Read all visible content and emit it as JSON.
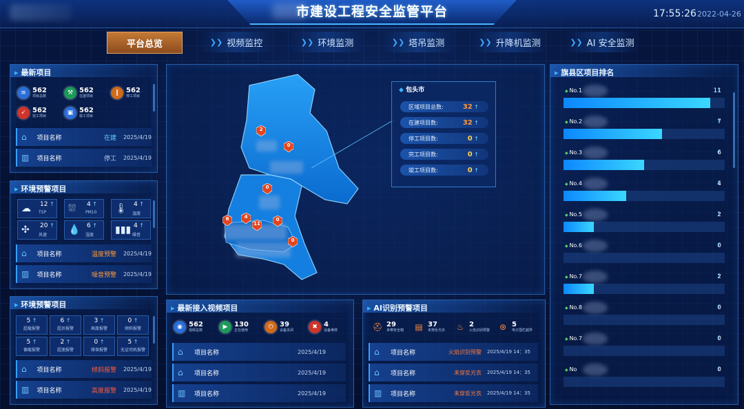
{
  "header": {
    "title": "市建设工程安全监管平台",
    "time": "17:55:26",
    "date": "2022-04-26"
  },
  "nav": {
    "tabs": [
      {
        "label": "平台总览",
        "active": true
      },
      {
        "label": "视频监控",
        "active": false
      },
      {
        "label": "环境监测",
        "active": false
      },
      {
        "label": "塔吊监测",
        "active": false
      },
      {
        "label": "升降机监测",
        "active": false
      },
      {
        "label": "AI 安全监测",
        "active": false
      }
    ]
  },
  "latest_projects": {
    "title": "最新项目",
    "stats": [
      {
        "value": "562",
        "label": "项目总数",
        "icon": "list-icon",
        "color": "#2a6fd8"
      },
      {
        "value": "562",
        "label": "在建项目",
        "icon": "build-icon",
        "color": "#1d9a5a"
      },
      {
        "value": "562",
        "label": "停工项目",
        "icon": "pause-icon",
        "color": "#d06a1a"
      },
      {
        "value": "562",
        "label": "完工项目",
        "icon": "check-icon",
        "color": "#d0342a"
      },
      {
        "value": "562",
        "label": "竣工项目",
        "icon": "done-icon",
        "color": "#2a6fd8"
      }
    ],
    "rows": [
      {
        "name": "项目名称",
        "status": "在建",
        "status_color": "#5fd0ff",
        "date": "2025/4/19"
      },
      {
        "name": "项目名称",
        "status": "停工",
        "status_color": "#b8c8e6",
        "date": "2025/4/19"
      }
    ]
  },
  "env_warning": {
    "title": "环境预警项目",
    "cells": [
      {
        "value": "12",
        "label": "TSP",
        "icon": "dust-icon"
      },
      {
        "value": "4",
        "label": "PM10",
        "icon": "pm-icon"
      },
      {
        "value": "4",
        "label": "温度",
        "icon": "thermometer-icon"
      },
      {
        "value": "20",
        "label": "风速",
        "icon": "fan-icon"
      },
      {
        "value": "6",
        "label": "湿度",
        "icon": "droplet-icon"
      },
      {
        "value": "4",
        "label": "噪音",
        "icon": "sound-icon"
      }
    ],
    "rows": [
      {
        "name": "项目名称",
        "status": "温度预警",
        "status_color": "#ff9a3a",
        "date": "2025/4/19"
      },
      {
        "name": "项目名称",
        "status": "噪音预警",
        "status_color": "#ff9a3a",
        "date": "2025/4/19"
      }
    ]
  },
  "crane_warning": {
    "title": "环境预警项目",
    "cells": [
      {
        "value": "5",
        "label": "超载报警"
      },
      {
        "value": "6",
        "label": "超员报警"
      },
      {
        "value": "3",
        "label": "高度报警"
      },
      {
        "value": "0",
        "label": "倾斜报警"
      },
      {
        "value": "5",
        "label": "偏载报警"
      },
      {
        "value": "2",
        "label": "超速报警"
      },
      {
        "value": "0",
        "label": "维保报警"
      },
      {
        "value": "5",
        "label": "无证司机报警"
      }
    ],
    "rows": [
      {
        "name": "项目名称",
        "status": "倾斜报警",
        "status_color": "#ff5a3a",
        "date": "2025/4/19"
      },
      {
        "name": "项目名称",
        "status": "高度报警",
        "status_color": "#ff5a3a",
        "date": "2025/4/19"
      }
    ]
  },
  "map": {
    "info_title": "包头市",
    "info_rows": [
      {
        "label": "区域项目总数:",
        "value": "32",
        "color": "#ff9a3a"
      },
      {
        "label": "在建项目数:",
        "value": "32",
        "color": "#ff9a3a"
      },
      {
        "label": "停工项目数:",
        "value": "0",
        "color": "#ffd24a"
      },
      {
        "label": "完工项目数:",
        "value": "0",
        "color": "#ffd24a"
      },
      {
        "label": "竣工项目数:",
        "value": "0",
        "color": "#ffd24a"
      }
    ],
    "markers": [
      "2",
      "0",
      "0",
      "6",
      "4",
      "11",
      "0",
      "0"
    ]
  },
  "ranking": {
    "title": "旗县区项目排名",
    "items": [
      {
        "label": "No.1",
        "value": "11",
        "fraction": 0.91
      },
      {
        "label": "No.2",
        "value": "7",
        "fraction": 0.61
      },
      {
        "label": "No.3",
        "value": "6",
        "fraction": 0.5
      },
      {
        "label": "No.4",
        "value": "4",
        "fraction": 0.39
      },
      {
        "label": "No.5",
        "value": "2",
        "fraction": 0.19
      },
      {
        "label": "No.6",
        "value": "0",
        "fraction": 0.0
      },
      {
        "label": "No.7",
        "value": "2",
        "fraction": 0.19
      },
      {
        "label": "No.8",
        "value": "0",
        "fraction": 0.0
      },
      {
        "label": "No.7",
        "value": "0",
        "fraction": 0.0
      },
      {
        "label": "No",
        "value": "0",
        "fraction": 0.0
      }
    ]
  },
  "video_projects": {
    "title": "最新接入视频项目",
    "stats": [
      {
        "value": "562",
        "label": "视频总数",
        "icon": "camera-icon",
        "color": "#2a6fd8"
      },
      {
        "value": "130",
        "label": "正在使用",
        "icon": "play-icon",
        "color": "#1d9a5a"
      },
      {
        "value": "39",
        "label": "设备关闭",
        "icon": "power-icon",
        "color": "#d06a1a"
      },
      {
        "value": "4",
        "label": "设备维修",
        "icon": "wrench-icon",
        "color": "#d0342a"
      }
    ],
    "rows": [
      {
        "name": "项目名称",
        "date": "2025/4/19"
      },
      {
        "name": "项目名称",
        "date": "2025/4/19"
      },
      {
        "name": "项目名称",
        "date": "2025/4/19"
      }
    ]
  },
  "ai_warning": {
    "title": "AI识别预警项目",
    "stats": [
      {
        "value": "29",
        "label": "未带安全帽",
        "icon": "helmet-icon"
      },
      {
        "value": "37",
        "label": "未穿反光衣",
        "icon": "vest-icon"
      },
      {
        "value": "2",
        "label": "火焰识别预警",
        "icon": "flame-icon"
      },
      {
        "value": "5",
        "label": "电子围栏越界",
        "icon": "fence-icon"
      }
    ],
    "rows": [
      {
        "name": "项目名称",
        "status": "火焰识别预警",
        "date": "2025/4/19  14：35"
      },
      {
        "name": "项目名称",
        "status": "未穿反光衣",
        "date": "2025/4/19  14：35"
      },
      {
        "name": "项目名称",
        "status": "未穿反光衣",
        "date": "2025/4/19  14：35"
      }
    ]
  }
}
